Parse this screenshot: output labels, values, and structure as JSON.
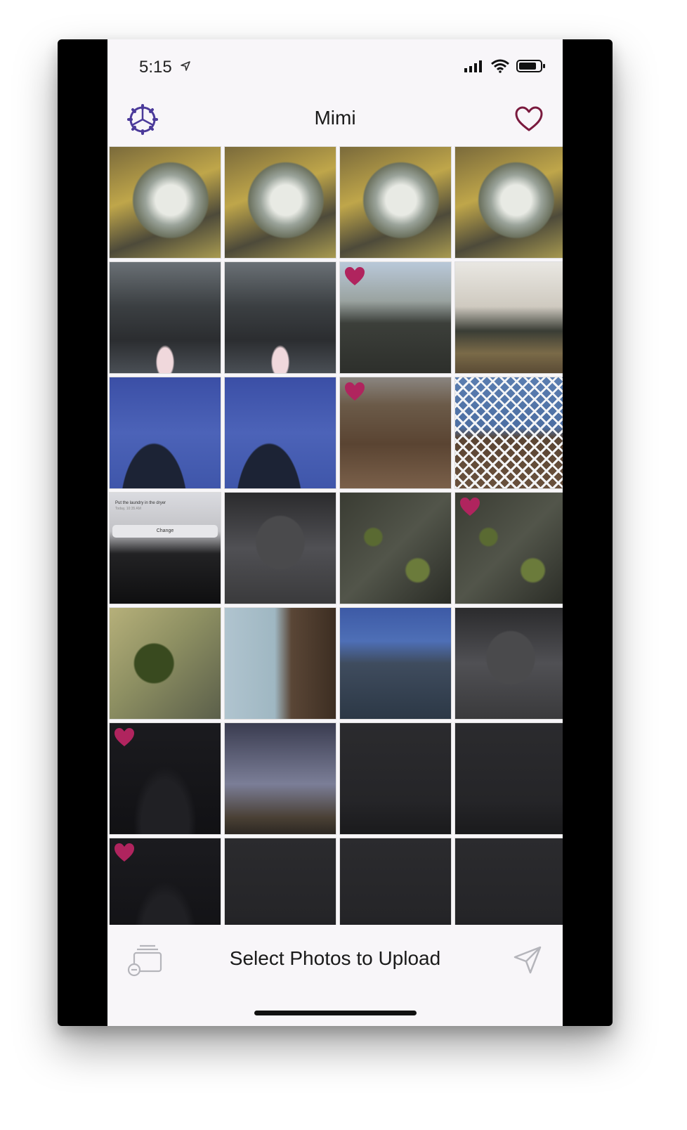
{
  "status": {
    "time": "5:15"
  },
  "nav": {
    "title": "Mimi",
    "settings_icon": "gear-icon",
    "favorites_icon": "heart-outline-icon"
  },
  "colors": {
    "accent": "#4b3a9a",
    "heart": "#7a1a3e",
    "favorite_badge": "#b0245e"
  },
  "photos": [
    {
      "favorite": false
    },
    {
      "favorite": false
    },
    {
      "favorite": false
    },
    {
      "favorite": false
    },
    {
      "favorite": false
    },
    {
      "favorite": false
    },
    {
      "favorite": true
    },
    {
      "favorite": false
    },
    {
      "favorite": false
    },
    {
      "favorite": false
    },
    {
      "favorite": true
    },
    {
      "favorite": false
    },
    {
      "favorite": false,
      "text": [
        "Put the laundry in the dryer",
        "Today, 10:35 AM",
        "Change"
      ]
    },
    {
      "favorite": false
    },
    {
      "favorite": false
    },
    {
      "favorite": true
    },
    {
      "favorite": false
    },
    {
      "favorite": false
    },
    {
      "favorite": false
    },
    {
      "favorite": false
    },
    {
      "favorite": true
    },
    {
      "favorite": false
    },
    {
      "favorite": false
    },
    {
      "favorite": false
    },
    {
      "favorite": true
    },
    {
      "favorite": false
    },
    {
      "favorite": false
    },
    {
      "favorite": false
    }
  ],
  "bottom": {
    "label": "Select Photos to Upload",
    "left_icon": "photo-stack-icon",
    "right_icon": "send-icon"
  }
}
